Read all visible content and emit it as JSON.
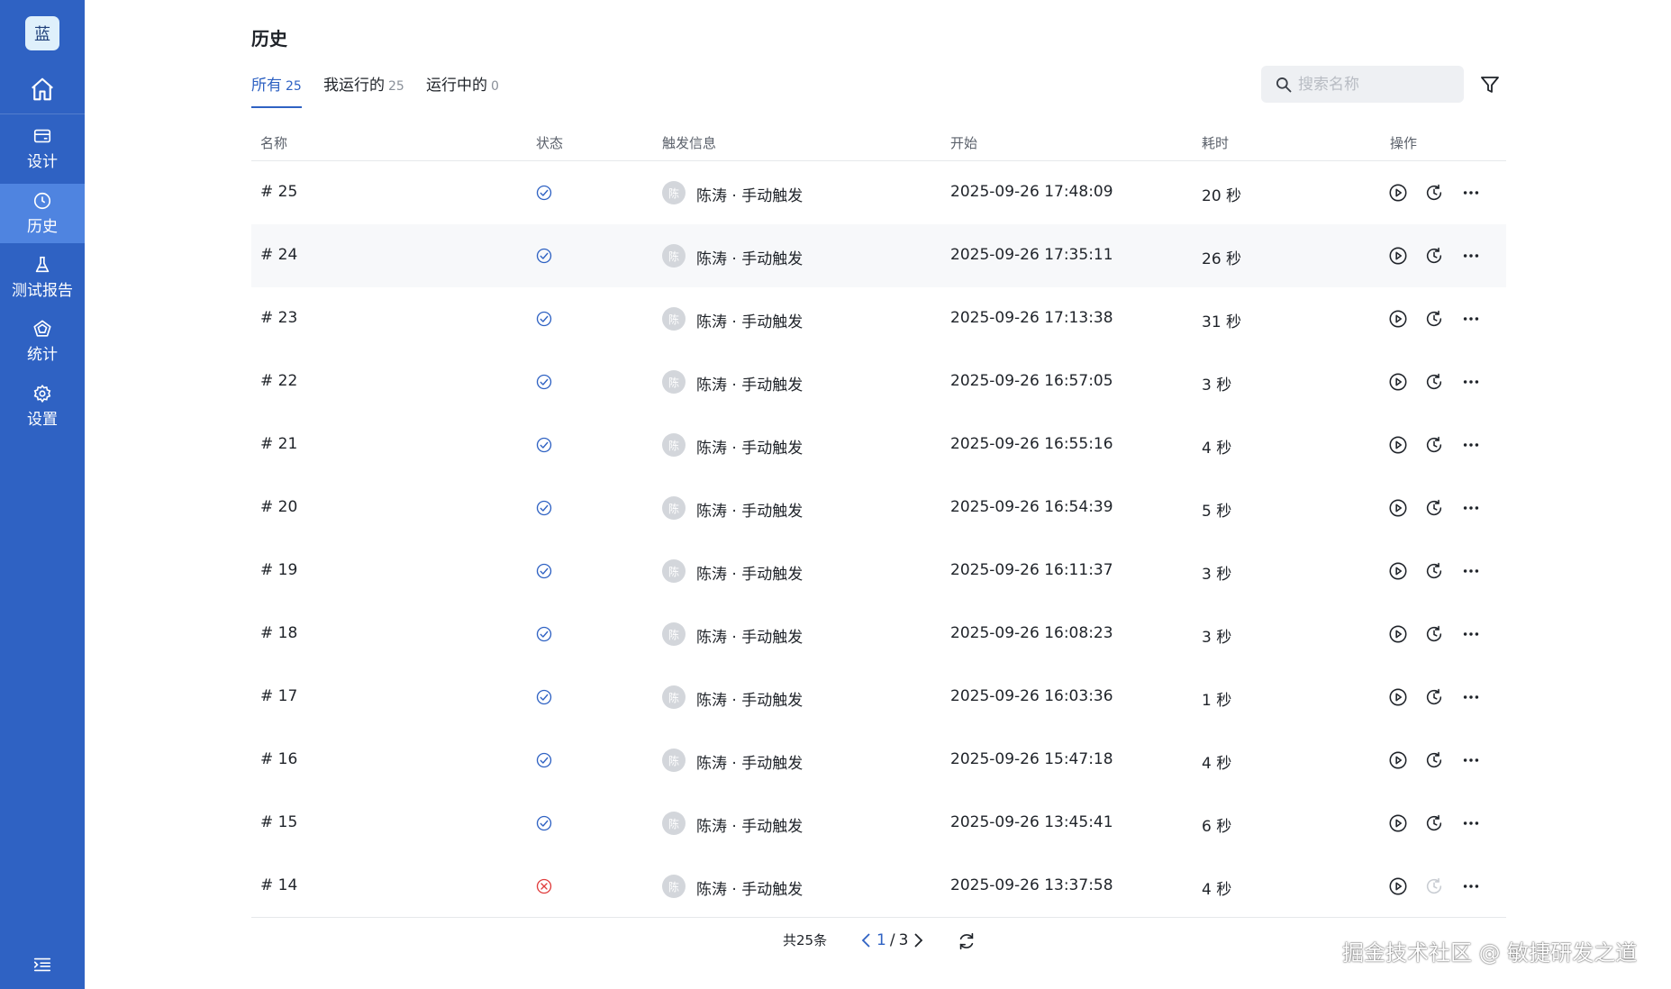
{
  "brand": {
    "text": "蓝"
  },
  "sidebar": {
    "items": [
      {
        "label": "设计"
      },
      {
        "label": "历史"
      },
      {
        "label": "测试报告"
      },
      {
        "label": "统计"
      },
      {
        "label": "设置"
      }
    ]
  },
  "page": {
    "title": "历史"
  },
  "tabs": [
    {
      "label": "所有",
      "count": "25"
    },
    {
      "label": "我运行的",
      "count": "25"
    },
    {
      "label": "运行中的",
      "count": "0"
    }
  ],
  "search": {
    "placeholder": "搜索名称"
  },
  "table": {
    "headers": {
      "name": "名称",
      "status": "状态",
      "trigger": "触发信息",
      "start": "开始",
      "duration": "耗时",
      "actions": "操作"
    },
    "rows": [
      {
        "name": "# 25",
        "status": "success",
        "avatar": "陈",
        "trigger": "陈涛 · 手动触发",
        "start": "2025-09-26 17:48:09",
        "duration": "20 秒"
      },
      {
        "name": "# 24",
        "status": "success",
        "avatar": "陈",
        "trigger": "陈涛 · 手动触发",
        "start": "2025-09-26 17:35:11",
        "duration": "26 秒"
      },
      {
        "name": "# 23",
        "status": "success",
        "avatar": "陈",
        "trigger": "陈涛 · 手动触发",
        "start": "2025-09-26 17:13:38",
        "duration": "31 秒"
      },
      {
        "name": "# 22",
        "status": "success",
        "avatar": "陈",
        "trigger": "陈涛 · 手动触发",
        "start": "2025-09-26 16:57:05",
        "duration": "3 秒"
      },
      {
        "name": "# 21",
        "status": "success",
        "avatar": "陈",
        "trigger": "陈涛 · 手动触发",
        "start": "2025-09-26 16:55:16",
        "duration": "4 秒"
      },
      {
        "name": "# 20",
        "status": "success",
        "avatar": "陈",
        "trigger": "陈涛 · 手动触发",
        "start": "2025-09-26 16:54:39",
        "duration": "5 秒"
      },
      {
        "name": "# 19",
        "status": "success",
        "avatar": "陈",
        "trigger": "陈涛 · 手动触发",
        "start": "2025-09-26 16:11:37",
        "duration": "3 秒"
      },
      {
        "name": "# 18",
        "status": "success",
        "avatar": "陈",
        "trigger": "陈涛 · 手动触发",
        "start": "2025-09-26 16:08:23",
        "duration": "3 秒"
      },
      {
        "name": "# 17",
        "status": "success",
        "avatar": "陈",
        "trigger": "陈涛 · 手动触发",
        "start": "2025-09-26 16:03:36",
        "duration": "1 秒"
      },
      {
        "name": "# 16",
        "status": "success",
        "avatar": "陈",
        "trigger": "陈涛 · 手动触发",
        "start": "2025-09-26 15:47:18",
        "duration": "4 秒"
      },
      {
        "name": "# 15",
        "status": "success",
        "avatar": "陈",
        "trigger": "陈涛 · 手动触发",
        "start": "2025-09-26 13:45:41",
        "duration": "6 秒"
      },
      {
        "name": "# 14",
        "status": "failed",
        "avatar": "陈",
        "trigger": "陈涛 · 手动触发",
        "start": "2025-09-26 13:37:58",
        "duration": "4 秒"
      }
    ]
  },
  "pagination": {
    "total": "共25条",
    "current": "1",
    "separator": "/",
    "pages": "3"
  },
  "watermark": {
    "text": "掘金技术社区 @ 敏捷研发之道"
  },
  "colors": {
    "sidebar": "#2f62c3",
    "sidebar_active": "#4f84e0",
    "accent": "#2f62c3",
    "success": "#2f62c3",
    "error": "#e03c3c"
  }
}
